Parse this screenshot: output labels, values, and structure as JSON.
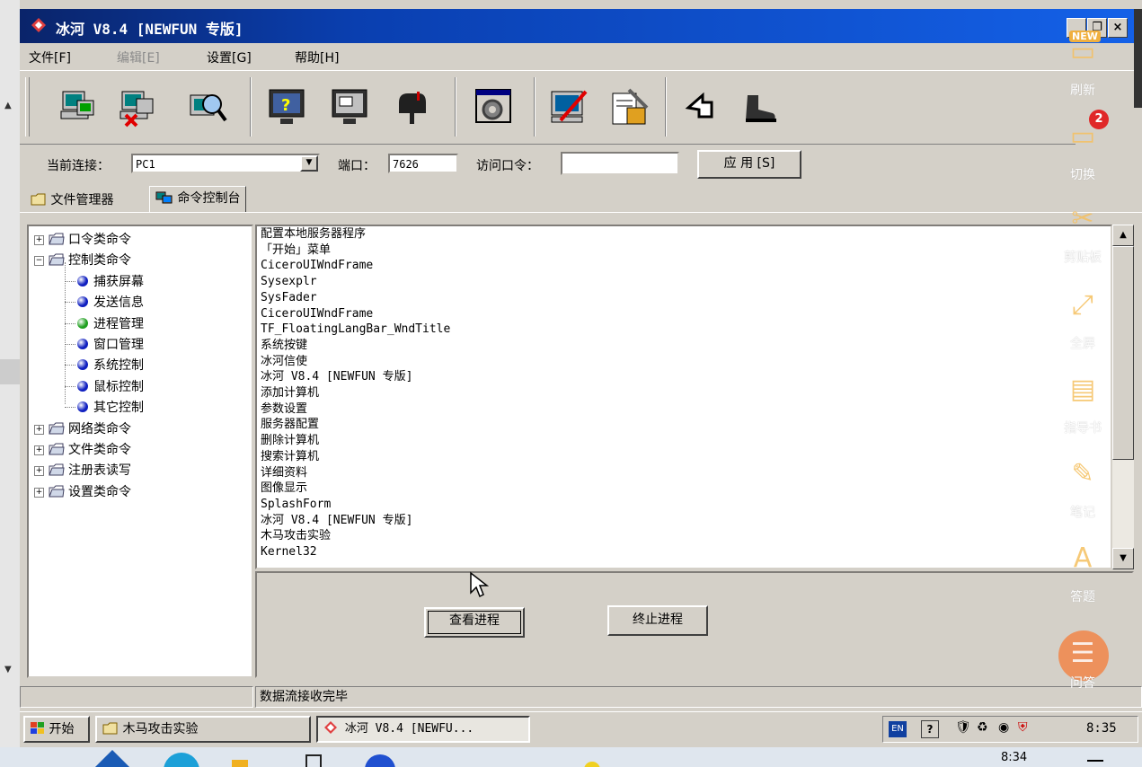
{
  "window": {
    "title": "冰河 V8.4 [NEWFUN 专版]",
    "controls": {
      "minimize": "_",
      "restore": "🗗",
      "close": "×"
    }
  },
  "menu": [
    {
      "label": "文件[F]",
      "enabled": true
    },
    {
      "label": "编辑[E]",
      "enabled": false
    },
    {
      "label": "设置[G]",
      "enabled": true
    },
    {
      "label": "帮助[H]",
      "enabled": true
    }
  ],
  "toolbar": {
    "icons": [
      "add-computer-icon",
      "delete-computer-icon",
      "search-computer-icon",
      "help-monitor-icon",
      "screen-capture-icon",
      "mailbox-icon",
      "settings-gear-icon",
      "edit-server-icon",
      "config-tools-icon",
      "up-arrow-icon",
      "boot-icon"
    ]
  },
  "connection": {
    "current_label": "当前连接：",
    "current_value": "PC1",
    "port_label": "端口：",
    "port_value": "7626",
    "password_label": "访问口令：",
    "password_value": "",
    "apply_button": "应 用 [S]"
  },
  "tabs": [
    {
      "label": "文件管理器",
      "active": false
    },
    {
      "label": "命令控制台",
      "active": true
    }
  ],
  "tree": {
    "nodes": [
      {
        "label": "口令类命令",
        "type": "folder",
        "expanded": false
      },
      {
        "label": "控制类命令",
        "type": "folder",
        "expanded": true
      },
      {
        "label": "捕获屏幕",
        "type": "leaf",
        "color": "#1020c0"
      },
      {
        "label": "发送信息",
        "type": "leaf",
        "color": "#1020c0"
      },
      {
        "label": "进程管理",
        "type": "leaf",
        "color": "#20a020"
      },
      {
        "label": "窗口管理",
        "type": "leaf",
        "color": "#1020c0"
      },
      {
        "label": "系统控制",
        "type": "leaf",
        "color": "#1020c0"
      },
      {
        "label": "鼠标控制",
        "type": "leaf",
        "color": "#1020c0"
      },
      {
        "label": "其它控制",
        "type": "leaf",
        "color": "#1020c0"
      },
      {
        "label": "网络类命令",
        "type": "folder",
        "expanded": false
      },
      {
        "label": "文件类命令",
        "type": "folder",
        "expanded": false
      },
      {
        "label": "注册表读写",
        "type": "folder",
        "expanded": false
      },
      {
        "label": "设置类命令",
        "type": "folder",
        "expanded": false
      }
    ]
  },
  "process_list": [
    "配置本地服务器程序",
    "「开始」菜单",
    "CiceroUIWndFrame",
    "Sysexplr",
    "SysFader",
    "CiceroUIWndFrame",
    "TF_FloatingLangBar_WndTitle",
    "系统按键",
    "冰河信使",
    "冰河 V8.4 [NEWFUN 专版]",
    "添加计算机",
    "参数设置",
    "服务器配置",
    "删除计算机",
    "搜索计算机",
    "详细资料",
    "图像显示",
    "SplashForm",
    "冰河 V8.4 [NEWFUN 专版]",
    "木马攻击实验",
    "Kernel32"
  ],
  "actions": {
    "view_process": "查看进程",
    "kill_process": "终止进程"
  },
  "status": {
    "message": "数据流接收完毕"
  },
  "taskbar": {
    "start": "开始",
    "items": [
      {
        "label": "木马攻击实验",
        "active": false
      },
      {
        "label": "冰河 V8.4 [NEWFU...",
        "active": true
      }
    ],
    "lang": "EN",
    "clock": "8:35"
  },
  "host": {
    "clock": "8:34"
  },
  "side_panel": {
    "items": [
      {
        "label": "刷新",
        "icon": "refresh-icon"
      },
      {
        "label": "切换",
        "icon": "switch-icon",
        "badge": "2"
      },
      {
        "label": "剪贴板",
        "icon": "clipboard-icon"
      },
      {
        "label": "全屏",
        "icon": "fullscreen-icon"
      },
      {
        "label": "指导书",
        "icon": "guide-book-icon"
      },
      {
        "label": "笔记",
        "icon": "pencil-icon"
      },
      {
        "label": "答题",
        "icon": "answer-icon"
      },
      {
        "label": "问答",
        "icon": "qa-icon"
      }
    ],
    "new_tag": "NEW"
  }
}
